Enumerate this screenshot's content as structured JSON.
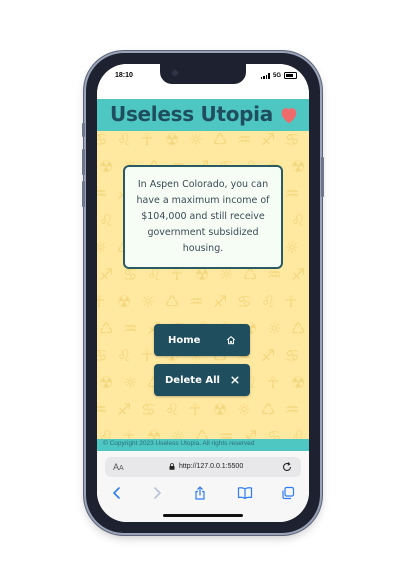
{
  "status_bar": {
    "time": "18:10",
    "network": "5G"
  },
  "header": {
    "title": "Useless Utopia",
    "icon": "heart-icon",
    "heart_color": "#ef6b6b",
    "bg_color": "#4ec7c2"
  },
  "fact": {
    "text": "In Aspen Colorado, you can have a maximum income of $104,000 and still receive government subsidized housing."
  },
  "buttons": {
    "home_label": "Home",
    "home_icon": "house-icon",
    "delete_label": "Delete All",
    "delete_icon": "close-icon"
  },
  "footer": {
    "copyright": "© Copyright 2023 Useless Utopia. All rights reserved"
  },
  "browser": {
    "text_size_label_big": "A",
    "text_size_label_small": "A",
    "url": "http://127.0.0.1:5500",
    "toolbar_icons": [
      "back-icon",
      "forward-icon",
      "share-icon",
      "bookmarks-icon",
      "tabs-icon"
    ]
  },
  "colors": {
    "accent": "#4ec7c2",
    "button": "#1f4f5e",
    "background": "#ffe9a0",
    "card_border": "#2a5a62"
  }
}
